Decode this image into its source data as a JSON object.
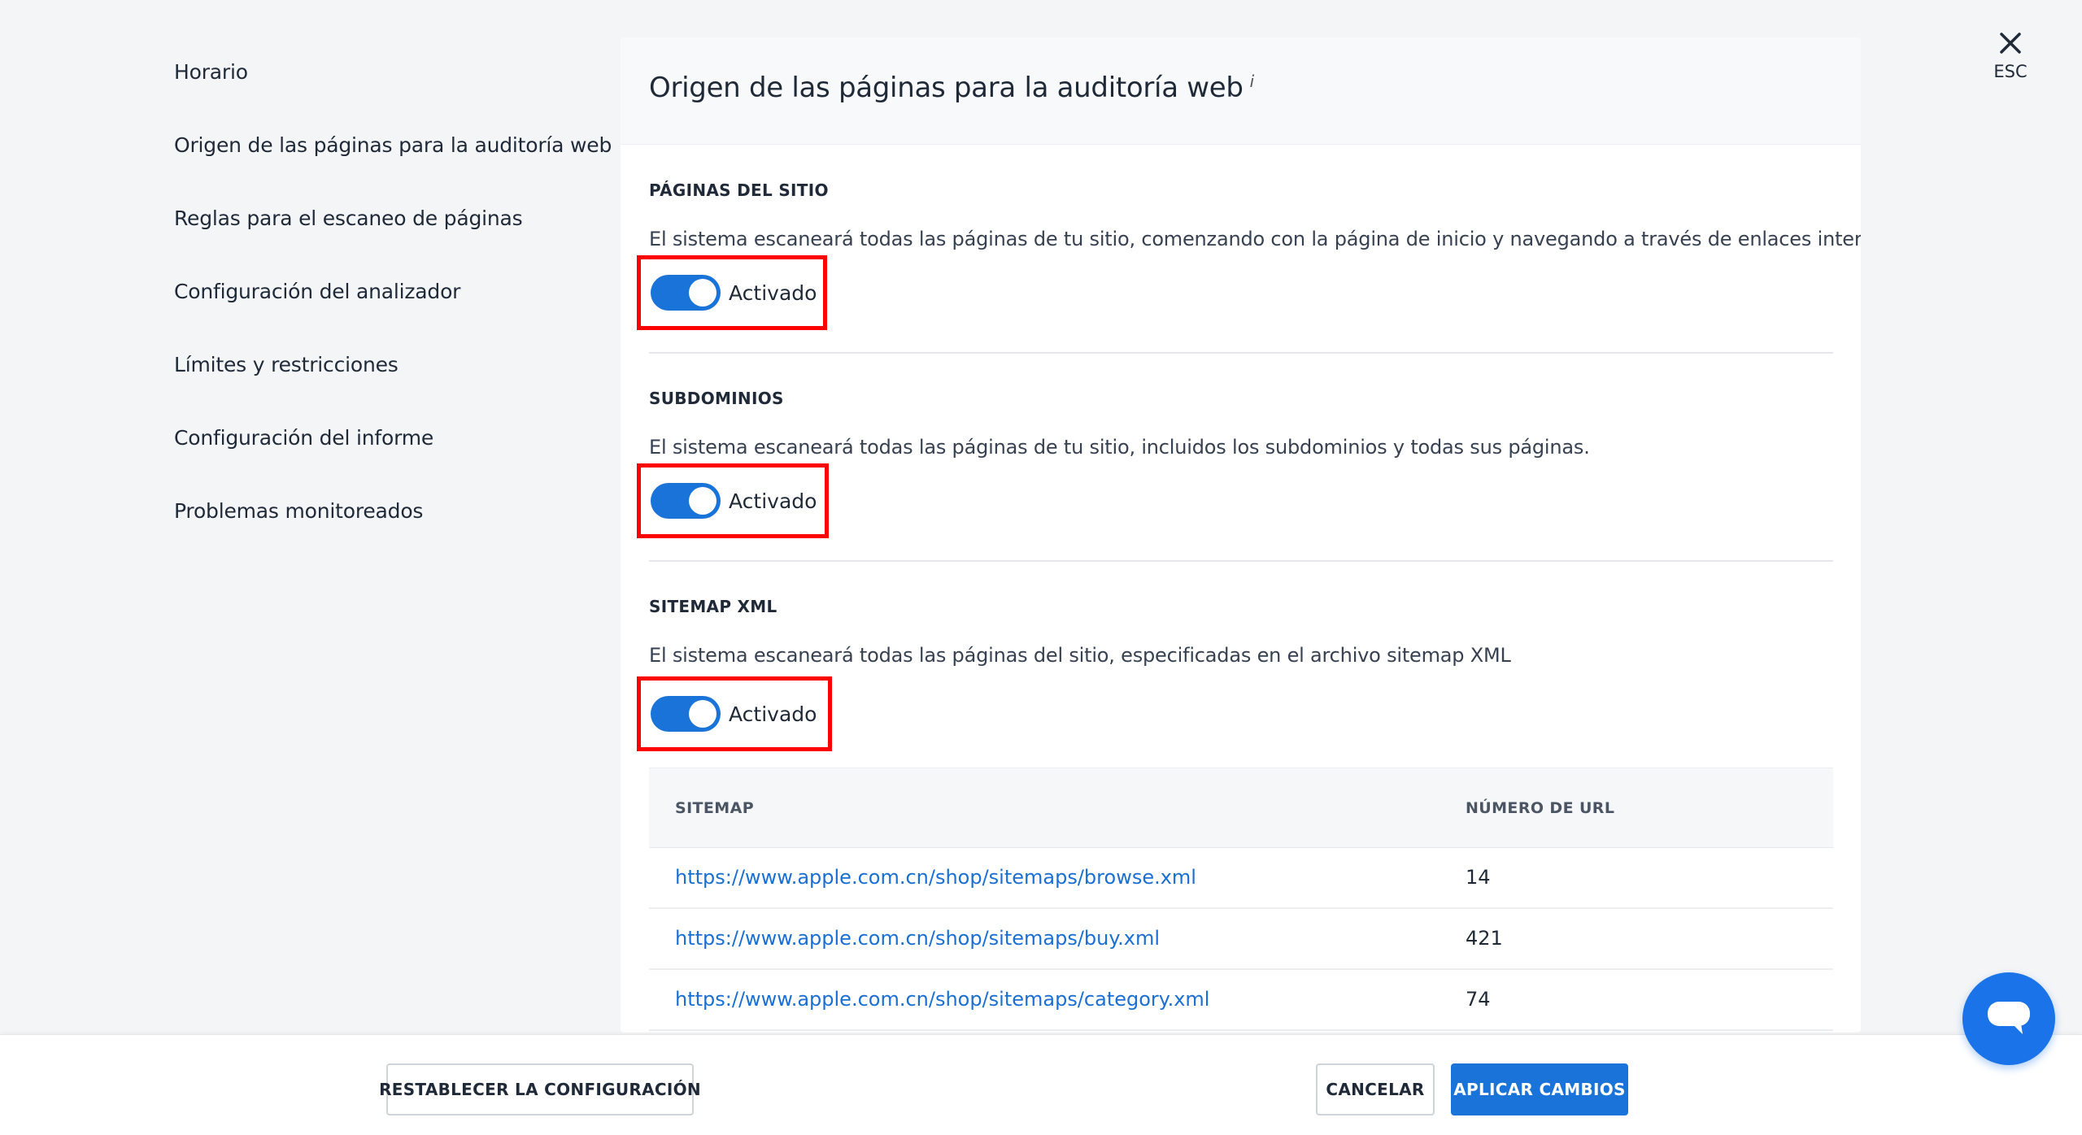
{
  "sidebar": {
    "items": [
      {
        "label": "Horario"
      },
      {
        "label": "Origen de las páginas para la auditoría web"
      },
      {
        "label": "Reglas para el escaneo de páginas"
      },
      {
        "label": "Configuración del analizador"
      },
      {
        "label": "Límites y restricciones"
      },
      {
        "label": "Configuración del informe"
      },
      {
        "label": "Problemas monitoreados"
      }
    ],
    "active_index": 1
  },
  "panel": {
    "title": "Origen de las páginas para la auditoría web",
    "info_icon": "i",
    "sections": [
      {
        "title": "PÁGINAS DEL SITIO",
        "description": "El sistema escaneará todas las páginas de tu sitio, comenzando con la página de inicio y navegando a través de enlaces internos.",
        "toggle_label": "Activado",
        "enabled": true
      },
      {
        "title": "SUBDOMINIOS",
        "description": "El sistema escaneará todas las páginas de tu sitio, incluidos los subdominios y todas sus páginas.",
        "toggle_label": "Activado",
        "enabled": true
      },
      {
        "title": "SITEMAP XML",
        "description": "El sistema escaneará todas las páginas del sitio, especificadas en el archivo sitemap XML",
        "toggle_label": "Activado",
        "enabled": true
      }
    ],
    "table": {
      "headers": [
        "SITEMAP",
        "NÚMERO DE URL"
      ],
      "rows": [
        {
          "url": "https://www.apple.com.cn/shop/sitemaps/browse.xml",
          "count": "14"
        },
        {
          "url": "https://www.apple.com.cn/shop/sitemaps/buy.xml",
          "count": "421"
        },
        {
          "url": "https://www.apple.com.cn/shop/sitemaps/category.xml",
          "count": "74"
        }
      ]
    }
  },
  "close": {
    "icon": "close-icon",
    "label": "ESC"
  },
  "footer": {
    "reset_label": "RESTABLECER LA CONFIGURACIÓN",
    "cancel_label": "CANCELAR",
    "apply_label": "APLICAR CAMBIOS"
  },
  "chat": {
    "icon": "chat-icon"
  },
  "colors": {
    "accent": "#1a73d9",
    "highlight": "#ff0000",
    "link": "#1a6fd4"
  }
}
